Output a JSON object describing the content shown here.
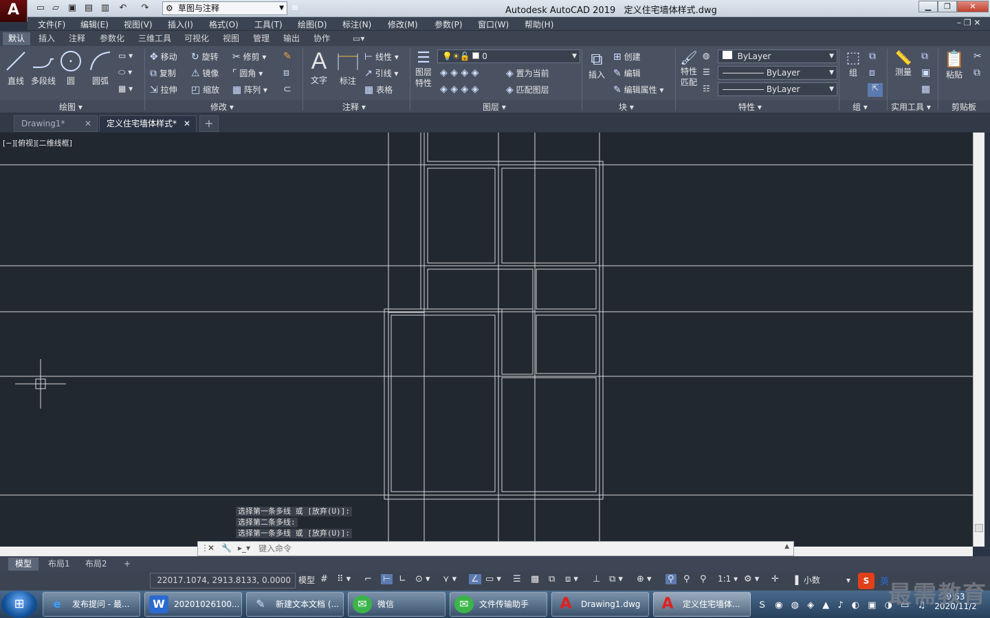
{
  "app": {
    "title": "Autodesk AutoCAD 2019",
    "file": "定义住宅墙体样式.dwg",
    "logo": "A"
  },
  "workspace": "草图与注释",
  "menu": [
    "文件(F)",
    "编辑(E)",
    "视图(V)",
    "插入(I)",
    "格式(O)",
    "工具(T)",
    "绘图(D)",
    "标注(N)",
    "修改(M)",
    "参数(P)",
    "窗口(W)",
    "帮助(H)"
  ],
  "ribbon_tabs": [
    "默认",
    "插入",
    "注释",
    "参数化",
    "三维工具",
    "可视化",
    "视图",
    "管理",
    "输出",
    "协作"
  ],
  "draw": {
    "line": "直线",
    "pline": "多段线",
    "circle": "圆",
    "arc": "圆弧",
    "panel": "绘图"
  },
  "modify": {
    "move": "移动",
    "rotate": "旋转",
    "trim": "修剪",
    "copy": "复制",
    "mirror": "镜像",
    "fillet": "圆角",
    "stretch": "拉伸",
    "scale": "缩放",
    "array": "阵列",
    "panel": "修改"
  },
  "annot": {
    "text": "文字",
    "dim": "标注",
    "linear": "线性",
    "leader": "引线",
    "table": "表格",
    "panel": "注释"
  },
  "layers": {
    "props1": "图层",
    "props2": "特性",
    "current": "0",
    "setcurrent": "置为当前",
    "match": "匹配图层",
    "panel": "图层"
  },
  "block": {
    "insert": "插入",
    "create": "创建",
    "edit": "编辑",
    "editattr": "编辑属性",
    "panel": "块"
  },
  "props": {
    "match1": "特性",
    "match2": "匹配",
    "color": "ByLayer",
    "linetype": "ByLayer",
    "lineweight": "ByLayer",
    "panel": "特性"
  },
  "group": {
    "group": "组",
    "panel": "组"
  },
  "utils": {
    "measure": "测量",
    "panel": "实用工具"
  },
  "clip": {
    "paste": "粘贴",
    "panel": "剪贴板"
  },
  "doc_tabs": [
    "Drawing1*",
    "定义住宅墙体样式*"
  ],
  "viewport_label": "[−][俯视][二维线框]",
  "cmd_history": [
    "选择第一条多线 或 [放弃(U)]:",
    "选择第二条多线:",
    "选择第一条多线 或 [放弃(U)]:"
  ],
  "cmd_placeholder": "键入命令",
  "layout_tabs": [
    "模型",
    "布局1",
    "布局2"
  ],
  "status": {
    "coords": "22017.1074, 2913.8133, 0.0000",
    "model": "模型",
    "scale": "1:1",
    "units": "小数"
  },
  "taskbar": [
    "发布提问 - 最...",
    "20201026100...",
    "新建文本文档 (...",
    "微信",
    "文件传输助手",
    "Drawing1.dwg",
    "定义住宅墙体..."
  ],
  "clock": {
    "time": "9:53",
    "date": "2020/11/2"
  },
  "ime": "英",
  "watermark": "最需教育",
  "colors": {
    "canvas": "#212830",
    "ribbon": "#4a5262",
    "line": "#d8d8d8"
  }
}
